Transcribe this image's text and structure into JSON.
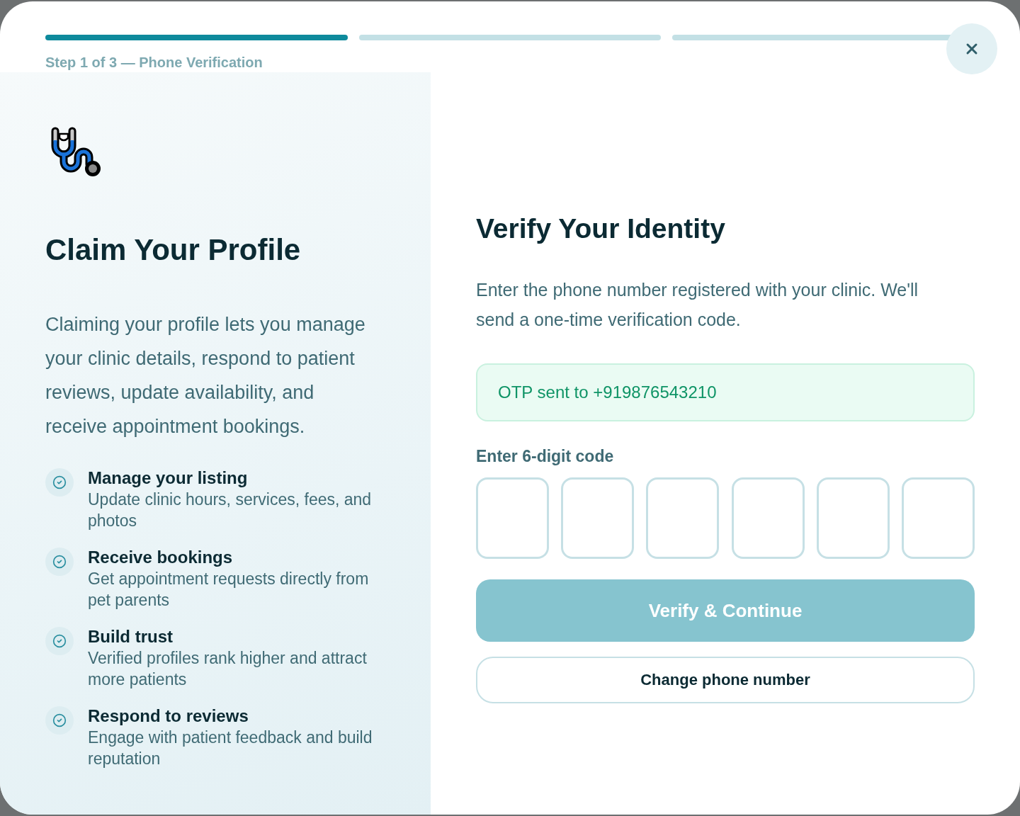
{
  "progress": [
    {
      "complete": true
    },
    {
      "complete": false
    },
    {
      "complete": false
    }
  ],
  "step_label": "Step 1 of 3 — Phone Verification",
  "intro": {
    "title": "Claim Your Profile",
    "description": "Claiming your profile lets you manage your clinic details, respond to patient reviews, update availability, and receive appointment bookings.",
    "benefits": [
      {
        "title": "Manage your listing",
        "description": "Update clinic hours, services, fees, and photos"
      },
      {
        "title": "Receive bookings",
        "description": "Get appointment requests directly from pet parents"
      },
      {
        "title": "Build trust",
        "description": "Verified profiles rank higher and attract more patients"
      },
      {
        "title": "Respond to reviews",
        "description": "Engage with patient feedback and build reputation"
      }
    ]
  },
  "verify": {
    "title": "Verify Your Identity",
    "description": "Enter the phone number registered with your clinic. We'll send a one-time verification code.",
    "notice": {
      "kind": "success",
      "text": "OTP sent to +919876543210"
    },
    "code_label": "Enter 6-digit code",
    "code_boxes": [
      {
        "focused": false
      },
      {
        "focused": false
      },
      {
        "focused": false
      },
      {
        "focused": false
      },
      {
        "focused": false
      },
      {
        "focused": false
      }
    ],
    "primary_button": {
      "label": "Verify & Continue",
      "disabled": true
    },
    "secondary_button": {
      "label": "Change phone number"
    }
  }
}
